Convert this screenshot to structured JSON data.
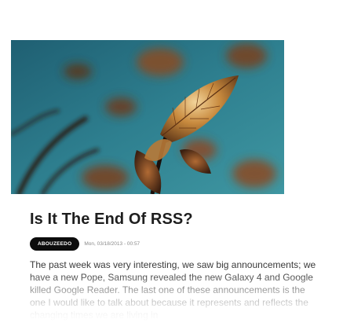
{
  "post": {
    "title": "Is It The End Of RSS?",
    "author": "ABOUZEEDO",
    "date": "Mon, 03/18/2013 - 00:57",
    "excerpt": "The past week was very interesting, we saw big announcements; we have a new Pope, Samsung revealed the new Galaxy 4 and Google killed Google Reader. The last one of these announcements is the one I would like to talk about because it represents and reflects the changing times we are living in"
  }
}
